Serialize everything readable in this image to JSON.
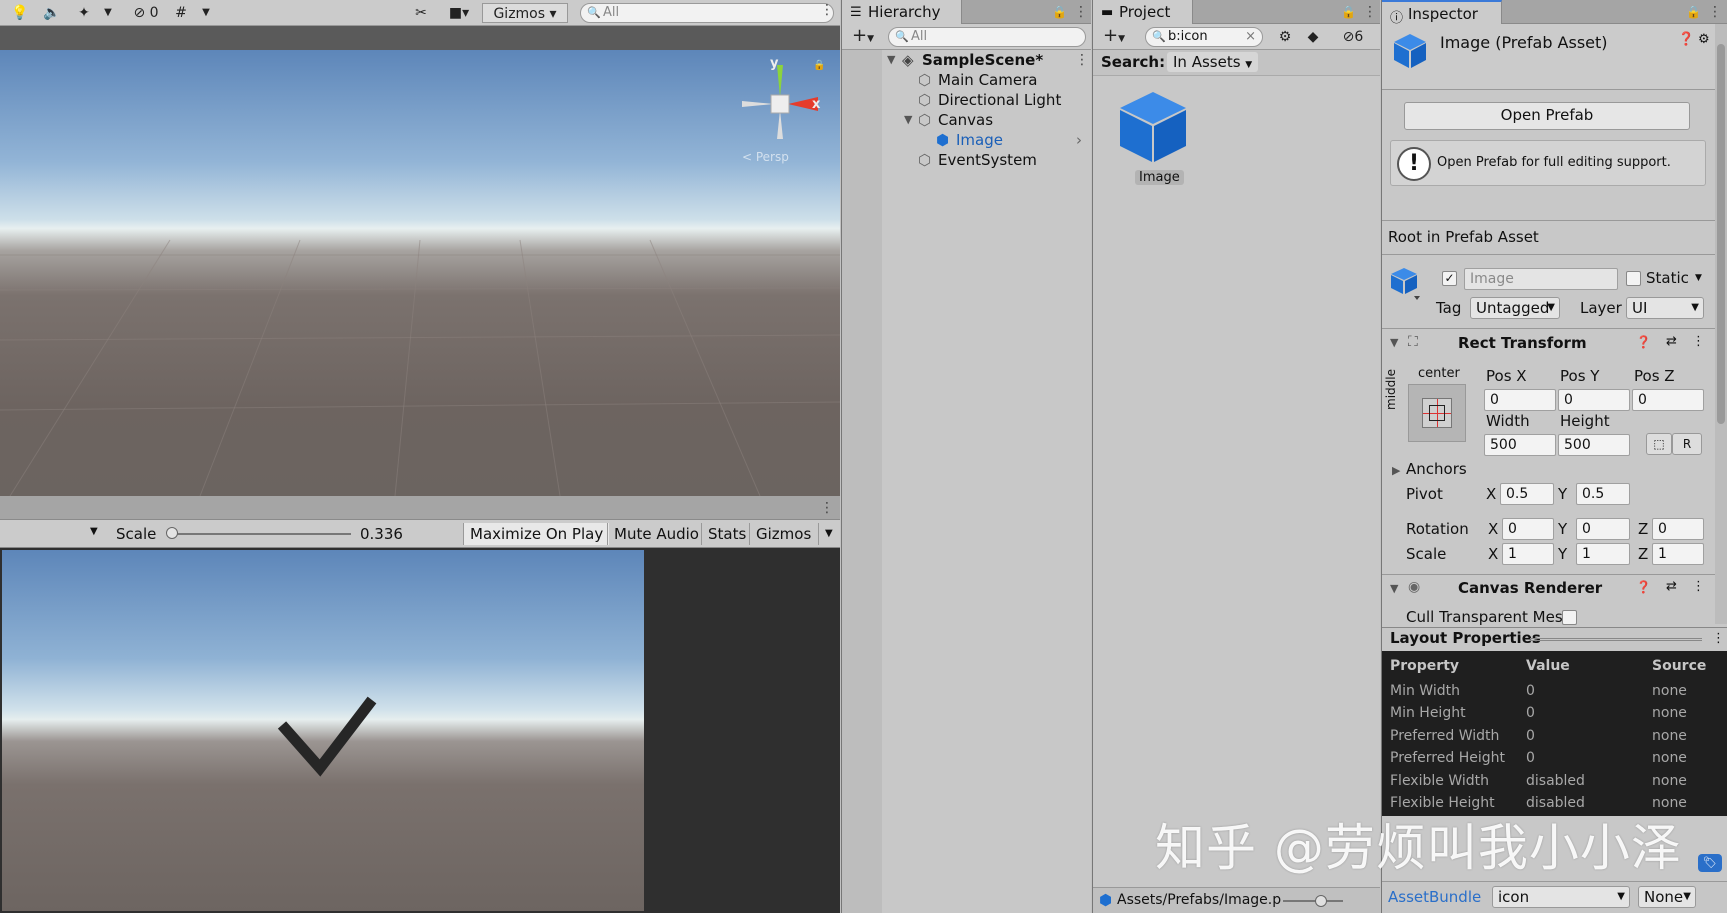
{
  "scene_toolbar": {
    "hidden_count": "0",
    "gizmos_label": "Gizmos",
    "search_placeholder": "All"
  },
  "scene_gizmo": {
    "y_label": "y",
    "x_label": "x",
    "persp_label": "< Persp"
  },
  "game": {
    "scale_label": "Scale",
    "scale_value": "0.336",
    "scale_fraction": 0.02,
    "buttons": [
      "Maximize On Play",
      "Mute Audio",
      "Stats",
      "Gizmos"
    ]
  },
  "hierarchy": {
    "tab_label": "Hierarchy",
    "search_placeholder": "All",
    "scene_name": "SampleScene*",
    "items": [
      {
        "label": "Main Camera"
      },
      {
        "label": "Directional Light"
      },
      {
        "label": "Canvas"
      },
      {
        "label": "Image"
      },
      {
        "label": "EventSystem"
      }
    ]
  },
  "project": {
    "tab_label": "Project",
    "search_value": "b:icon",
    "hidden_count": "6",
    "search_label": "Search:",
    "search_scope": "In Assets",
    "asset_name": "Image",
    "footer_path": "Assets/Prefabs/Image.p"
  },
  "inspector": {
    "tab_label": "Inspector",
    "title": "Image (Prefab Asset)",
    "open_prefab_label": "Open Prefab",
    "info_text": "Open Prefab for full editing support.",
    "root_label": "Root in Prefab Asset",
    "object_name": "Image",
    "static_label": "Static",
    "tag_label": "Tag",
    "tag_value": "Untagged",
    "layer_label": "Layer",
    "layer_value": "UI",
    "rect_transform": {
      "header": "Rect Transform",
      "anchor_h": "center",
      "anchor_v": "middle",
      "pos_x_label": "Pos X",
      "pos_y_label": "Pos Y",
      "pos_z_label": "Pos Z",
      "pos_x": "0",
      "pos_y": "0",
      "pos_z": "0",
      "width_label": "Width",
      "height_label": "Height",
      "width": "500",
      "height": "500",
      "r_label": "R",
      "anchors_label": "Anchors",
      "pivot_label": "Pivot",
      "pivot_x": "0.5",
      "pivot_y": "0.5",
      "rotation_label": "Rotation",
      "rot_x": "0",
      "rot_y": "0",
      "rot_z": "0",
      "scale_label": "Scale",
      "scale_x": "1",
      "scale_y": "1",
      "scale_z": "1",
      "x_label": "X",
      "y_label": "Y",
      "z_label": "Z"
    },
    "canvas_renderer": {
      "header": "Canvas Renderer",
      "cull_label": "Cull Transparent Mes"
    },
    "layout_properties": {
      "header": "Layout Properties",
      "columns": [
        "Property",
        "Value",
        "Source"
      ],
      "rows": [
        [
          "Min Width",
          "0",
          "none"
        ],
        [
          "Min Height",
          "0",
          "none"
        ],
        [
          "Preferred Width",
          "0",
          "none"
        ],
        [
          "Preferred Height",
          "0",
          "none"
        ],
        [
          "Flexible Width",
          "disabled",
          "none"
        ],
        [
          "Flexible Height",
          "disabled",
          "none"
        ]
      ]
    },
    "asset_bundle_label": "AssetBundle",
    "asset_bundle_value": "icon",
    "asset_bundle_variant": "None"
  },
  "watermark": "知乎 @劳烦叫我小小泽"
}
